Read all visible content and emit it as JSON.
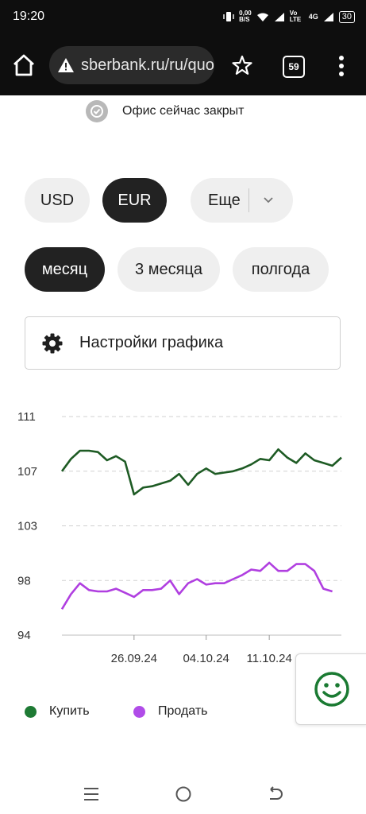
{
  "status_bar": {
    "time": "19:20",
    "net_speed_value": "0,00",
    "net_speed_unit": "B/S",
    "volte": "Vo LTE",
    "network": "4G",
    "battery": "30"
  },
  "browser": {
    "url": "sberbank.ru/ru/quotes",
    "tabs_count": "59",
    "icons": [
      "home-icon",
      "warning-icon",
      "star-icon",
      "tabs-icon",
      "more-vert-icon"
    ]
  },
  "office": {
    "status_text": "Офис сейчас закрыт",
    "icon": "clock-check-icon"
  },
  "currency_tabs": [
    {
      "label": "USD",
      "selected": false
    },
    {
      "label": "EUR",
      "selected": true
    }
  ],
  "more_label": "Еще",
  "period_tabs": [
    {
      "label": "месяц",
      "selected": true
    },
    {
      "label": "3 месяца",
      "selected": false
    },
    {
      "label": "полгода",
      "selected": false
    }
  ],
  "settings_label": "Настройки графика",
  "chart_data": {
    "type": "line",
    "title": "",
    "xlabel": "",
    "ylabel": "",
    "y_ticks": [
      "111",
      "107",
      "103",
      "98",
      "94"
    ],
    "y_tick_values": [
      111,
      107,
      103,
      99,
      95
    ],
    "ylim": [
      95,
      111
    ],
    "x_tick_labels": [
      "26.09.24",
      "04.10.24",
      "11.10.24"
    ],
    "x_tick_index": [
      8,
      16,
      23
    ],
    "grid": true,
    "legend_position": "bottom",
    "series": [
      {
        "name": "Купить",
        "color": "#1e5b24",
        "values": [
          107.0,
          107.9,
          108.5,
          108.5,
          108.4,
          107.8,
          108.1,
          107.7,
          105.3,
          105.8,
          105.9,
          106.1,
          106.3,
          106.8,
          106.0,
          106.8,
          107.2,
          106.8,
          106.9,
          107.0,
          107.2,
          107.5,
          107.9,
          107.8,
          108.6,
          108.0,
          107.6,
          108.3,
          107.8,
          107.6,
          107.4,
          108.0
        ]
      },
      {
        "name": "Продать",
        "color": "#b03fe0",
        "values": [
          96.9,
          98.0,
          98.8,
          98.3,
          98.2,
          98.2,
          98.4,
          98.1,
          97.8,
          98.3,
          98.3,
          98.4,
          99.0,
          98.0,
          98.8,
          99.1,
          98.7,
          98.8,
          98.8,
          99.1,
          99.4,
          99.8,
          99.7,
          100.3,
          99.7,
          99.7,
          100.2,
          100.2,
          99.7,
          98.4,
          98.2
        ]
      }
    ]
  },
  "legend": [
    {
      "label": "Купить",
      "color": "#1e7a34"
    },
    {
      "label": "Продать",
      "color": "#b04ce8"
    }
  ],
  "feedback_icon": "smiley-icon",
  "nav_bar": {
    "icons": [
      "menu-icon",
      "home-circle-icon",
      "back-icon"
    ]
  }
}
